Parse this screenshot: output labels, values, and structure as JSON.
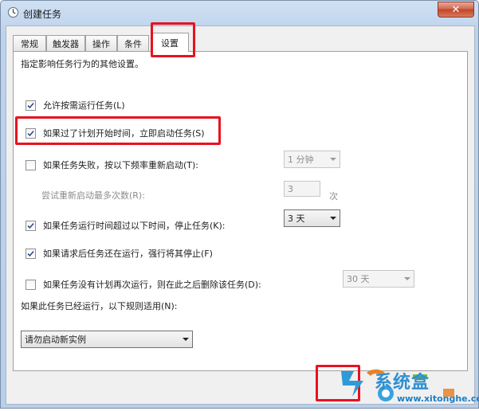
{
  "window": {
    "title": "创建任务",
    "close_glyph": "✕"
  },
  "tabs": [
    {
      "label": "常规",
      "active": false
    },
    {
      "label": "触发器",
      "active": false
    },
    {
      "label": "操作",
      "active": false
    },
    {
      "label": "条件",
      "active": false
    },
    {
      "label": "设置",
      "active": true
    }
  ],
  "settings": {
    "description": "指定影响任务行为的其他设置。",
    "allow_on_demand": {
      "label": "允许按需运行任务(L)",
      "checked": true
    },
    "run_if_missed": {
      "label": "如果过了计划开始时间，立即启动任务(S)",
      "checked": true
    },
    "restart_on_fail": {
      "label": "如果任务失败，按以下频率重新启动(T):",
      "checked": false,
      "interval": "1 分钟"
    },
    "restart_attempts": {
      "label": "尝试重新启动最多次数(R):",
      "value": "3",
      "unit": "次"
    },
    "stop_if_longer": {
      "label": "如果任务运行时间超过以下时间，停止任务(K):",
      "checked": true,
      "duration": "3 天"
    },
    "force_stop": {
      "label": "如果请求后任务还在运行，强行将其停止(F)",
      "checked": true
    },
    "delete_if_not_scheduled": {
      "label": "如果任务没有计划再次运行，则在此之后删除该任务(D):",
      "checked": false,
      "after": "30 天"
    },
    "rule_label": "如果此任务已经运行，以下规则适用(N):",
    "rule_value": "请勿启动新实例"
  },
  "watermark": {
    "text": "系统盒",
    "url": "www.xitonghe.com"
  },
  "colors": {
    "highlight": "#e8121f",
    "title_gradient": "#c3d7ee",
    "close": "#c14426"
  }
}
